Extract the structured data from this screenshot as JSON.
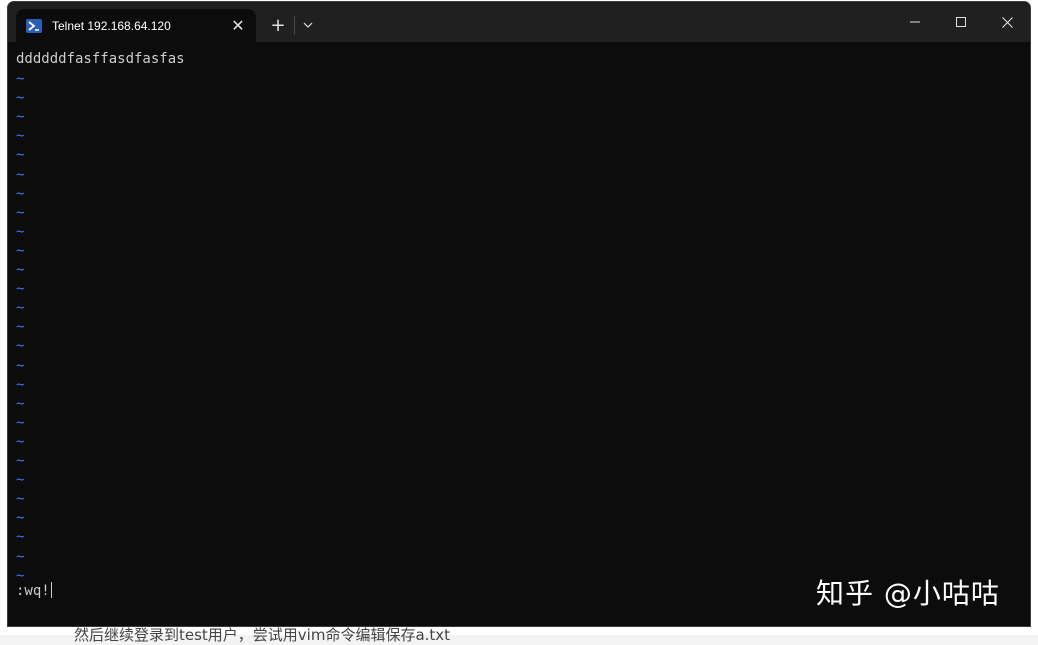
{
  "background_page": {
    "partial_text": "然后继续登录到test用户，尝试用vim命令编辑保存a.txt"
  },
  "window": {
    "tab": {
      "title": "Telnet 192.168.64.120",
      "icon": "powershell-icon",
      "close_label": "✕"
    },
    "new_tab_label": "+",
    "controls": {
      "minimize": "minimize-icon",
      "maximize": "maximize-icon",
      "close": "close-icon"
    }
  },
  "terminal": {
    "first_line": "ddddddfasffasdfasfas",
    "tilde_char": "~",
    "tilde_count": 27,
    "command_line": ":wq!"
  },
  "watermark": {
    "text": "知乎 @小咕咕"
  },
  "colors": {
    "terminal_bg": "#0c0c0c",
    "titlebar_bg": "#202020",
    "text": "#cccccc",
    "tilde": "#3b78ff"
  }
}
